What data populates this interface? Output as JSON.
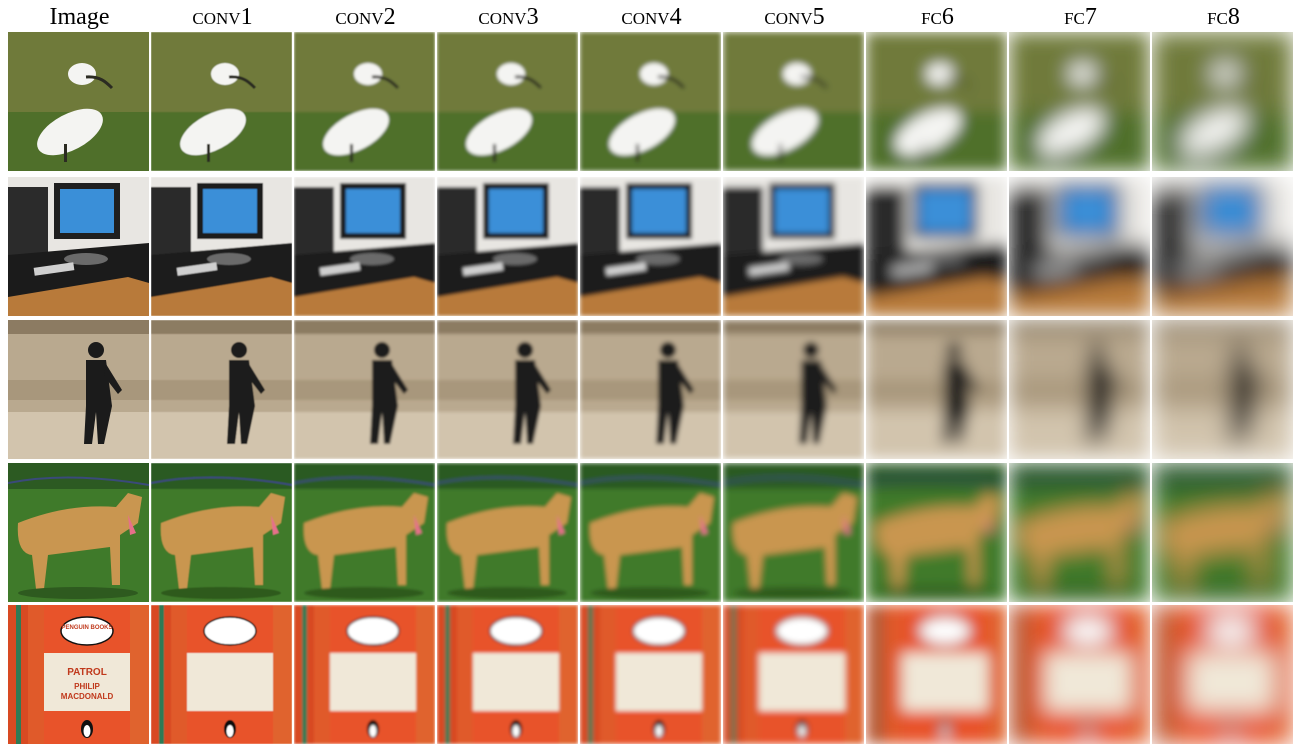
{
  "figure": {
    "columns": [
      "Image",
      "conv1",
      "conv2",
      "conv3",
      "conv4",
      "conv5",
      "fc6",
      "fc7",
      "fc8"
    ],
    "rows": [
      {
        "subject": "spoonbill",
        "bg": "#6f7a3a",
        "bg2": "#8c8c4a",
        "fg": "#f4f4f2",
        "accent": "#2b2b22"
      },
      {
        "subject": "computer-desk",
        "bg": "#e8e6e2",
        "bg2": "#2a2a2a",
        "fg": "#3a8fd8",
        "accent": "#b87a3a"
      },
      {
        "subject": "man-on-beach",
        "bg": "#b9a98f",
        "bg2": "#d2c4ad",
        "fg": "#1b1b1b",
        "accent": "#8c7b62"
      },
      {
        "subject": "dog",
        "bg": "#3f7a2a",
        "bg2": "#2c5a22",
        "fg": "#c99650",
        "accent": "#e6708a"
      },
      {
        "subject": "penguin-books",
        "bg": "#e8532a",
        "bg2": "#f0e8d8",
        "fg": "#ffffff",
        "accent": "#222222"
      }
    ],
    "book_text": {
      "publisher": "PENGUIN BOOKS",
      "title": "PATROL",
      "author_1": "PHILIP",
      "author_2": "MACDONALD"
    }
  }
}
